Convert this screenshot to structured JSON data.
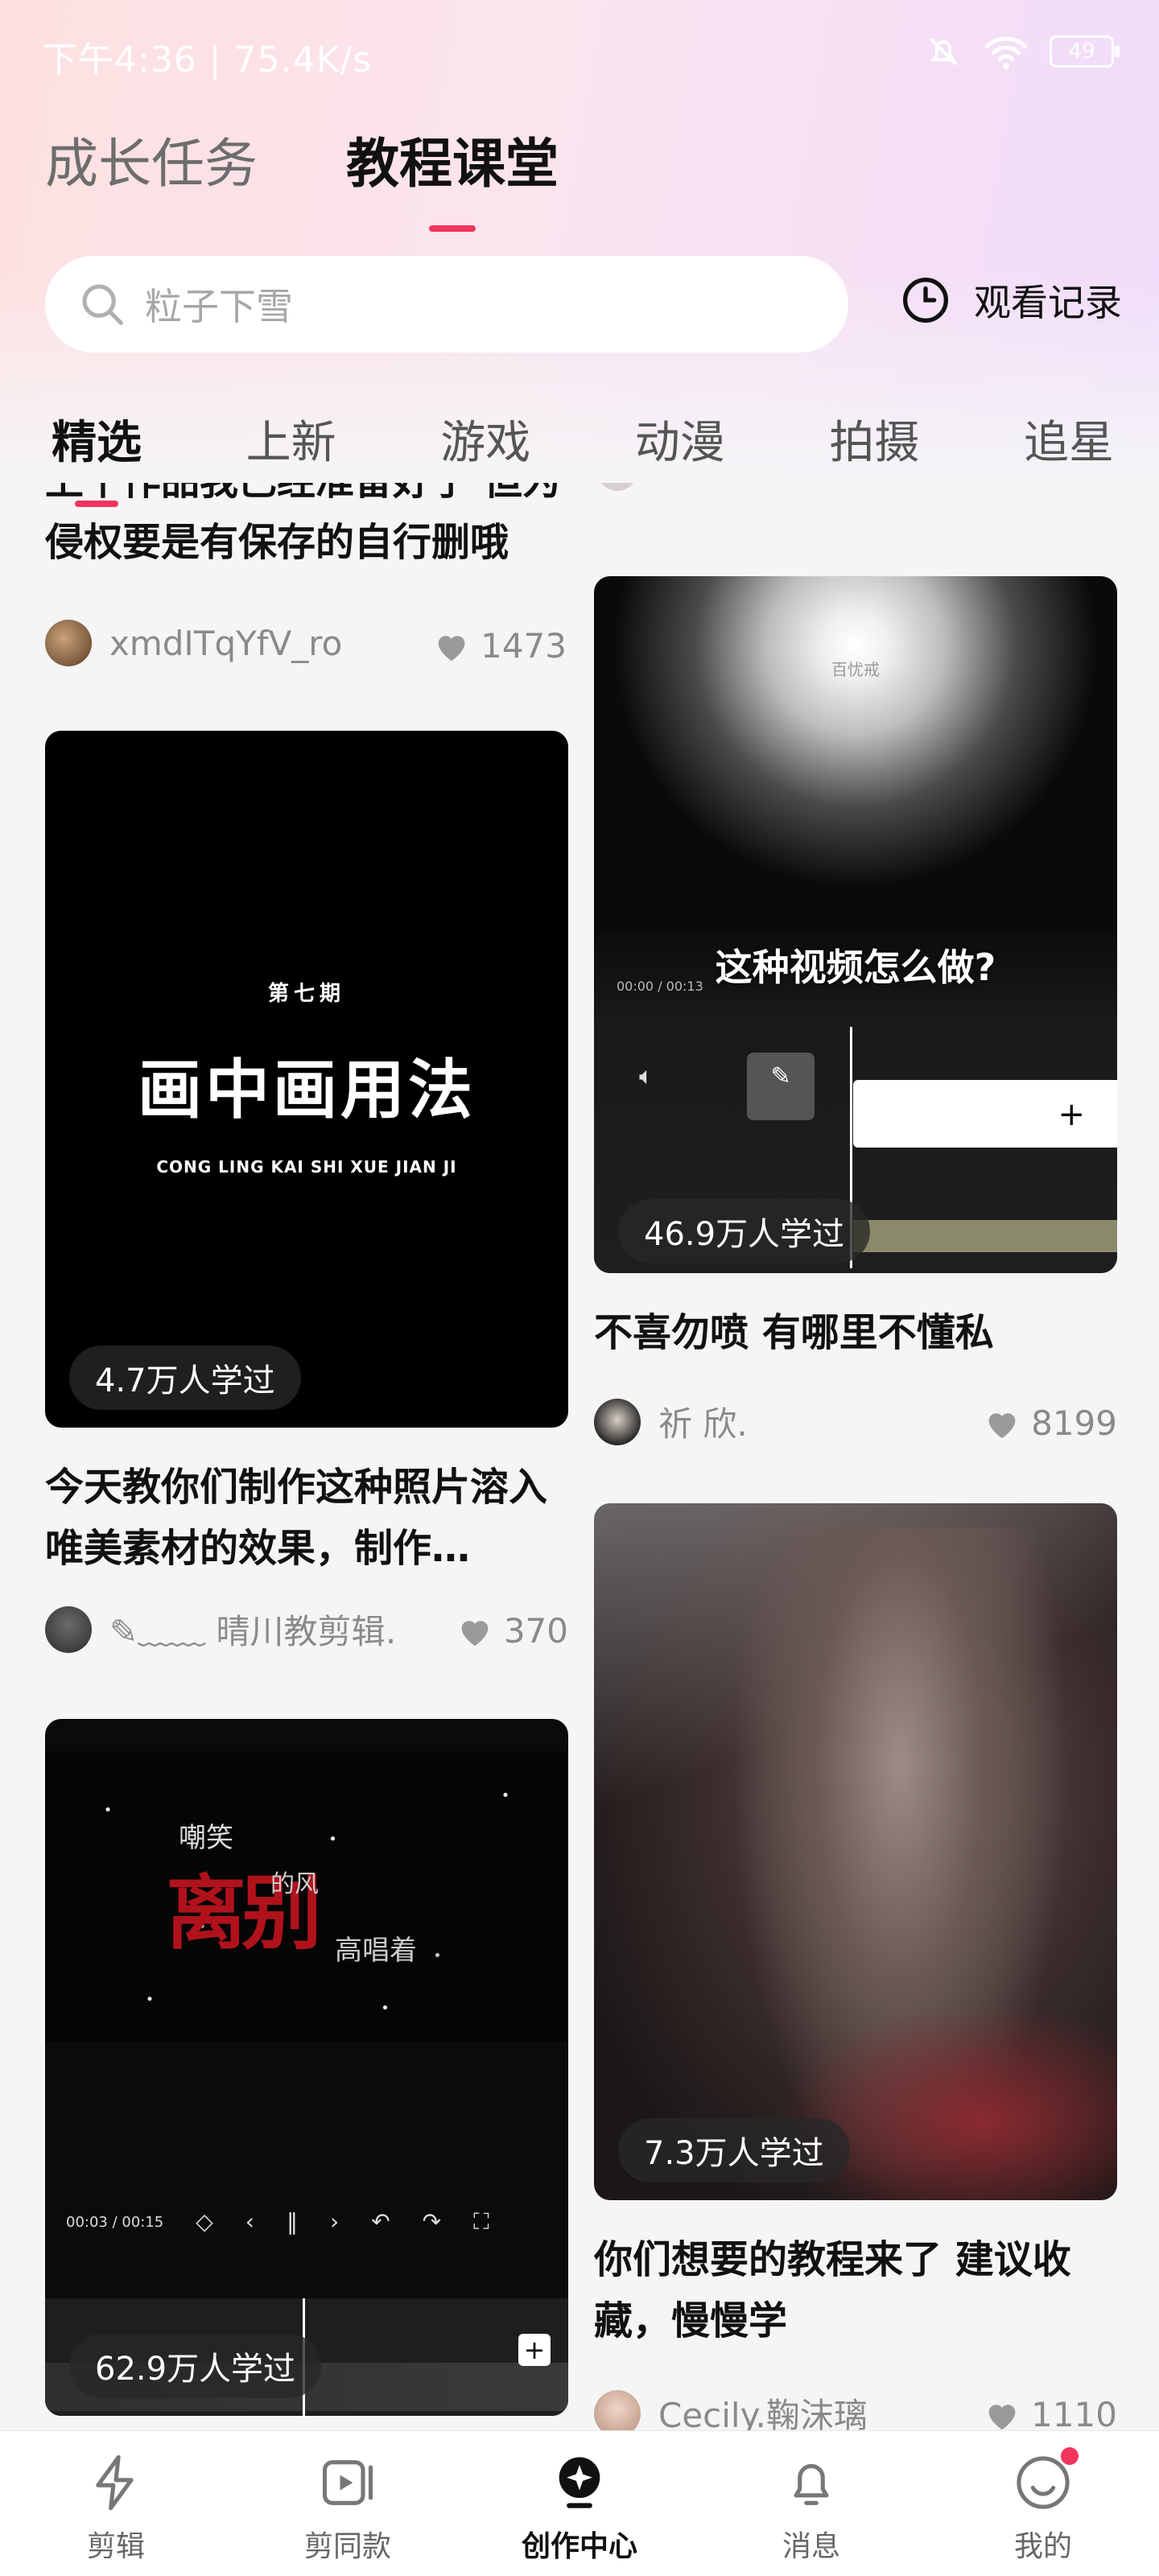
{
  "status_bar": {
    "time_speed": "下午4:36 | 75.4K/s",
    "battery": "49"
  },
  "header_tabs": [
    {
      "label": "成长任务",
      "active": false
    },
    {
      "label": "教程课堂",
      "active": true
    }
  ],
  "search": {
    "placeholder": "粒子下雪",
    "history_label": "观看记录"
  },
  "categories": [
    {
      "label": "精选",
      "active": true
    },
    {
      "label": "上新"
    },
    {
      "label": "游戏"
    },
    {
      "label": "动漫"
    },
    {
      "label": "拍摄"
    },
    {
      "label": "追星"
    }
  ],
  "cards": {
    "left0": {
      "title_line1": "上个作品我已经准备好了 但为",
      "title_line2": "侵权要是有保存的自行删哦",
      "author": "xmdITqYfV_ro",
      "likes": "1473"
    },
    "left1": {
      "overlay_small": "第七期",
      "overlay_big": "画中画用法",
      "overlay_en": "CONG LING KAI SHI XUE JIAN JI",
      "learned": "4.7万人学过",
      "title": "今天教你们制作这种照片溶入唯美素材的效果，制作…",
      "author": "✎﹏﹏ 晴川教剪辑…",
      "likes": "370"
    },
    "left2": {
      "learned": "62.9万人学过",
      "overlay_a": "离别",
      "overlay_b": "嘲笑",
      "overlay_c": "的风",
      "overlay_d": "高唱着",
      "timecode": "00:03 / 00:15"
    },
    "right1": {
      "overlay_caption": "这种视频怎么做?",
      "overlay_small": "百忧戒",
      "learned": "46.9万人学过",
      "title": "不喜勿喷 有哪里不懂私",
      "author": "祈 欣.",
      "likes": "8199",
      "timecode": "00:00 / 00:13"
    },
    "right2": {
      "learned": "7.3万人学过",
      "title_line1": "你们想要的教程来了 建议收",
      "title_line2": "藏，慢慢学",
      "author": "Cecily.鞠沫璃",
      "likes": "1110"
    }
  },
  "bottom_nav": [
    {
      "label": "剪辑",
      "icon": "cut-bolt-icon"
    },
    {
      "label": "剪同款",
      "icon": "video-template-icon"
    },
    {
      "label": "创作中心",
      "icon": "creation-center-icon",
      "active": true
    },
    {
      "label": "消息",
      "icon": "bell-icon"
    },
    {
      "label": "我的",
      "icon": "profile-smile-icon",
      "badge": true
    }
  ],
  "colors": {
    "accent": "#f3345d",
    "background": "#f5f5f7"
  }
}
